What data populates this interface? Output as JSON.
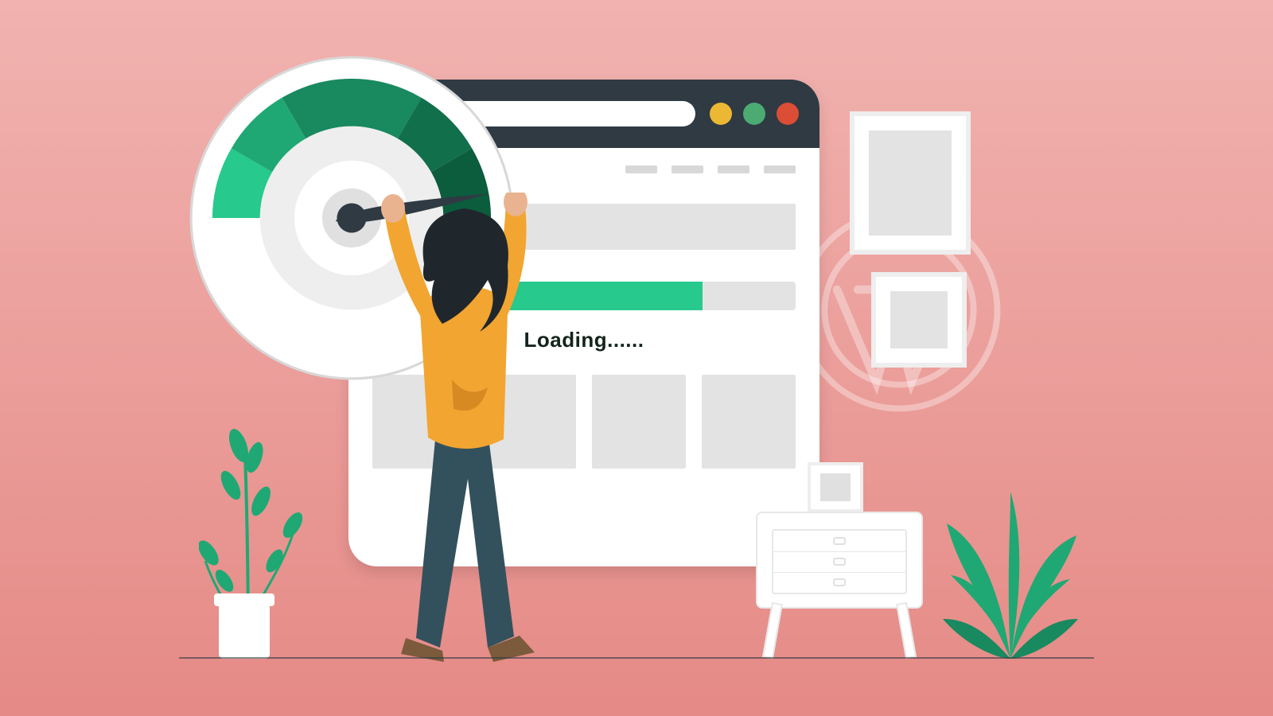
{
  "browser": {
    "header_dot_colors": {
      "yellow": "#ecb834",
      "green": "#4bab72",
      "red": "#db4d34"
    },
    "nav_dash_count": 4,
    "loading_label": "Loading......",
    "progress_percent": 78,
    "thumbnail_count": 4
  },
  "gauge": {
    "segments": [
      "#27c98d",
      "#1fa874",
      "#19895f",
      "#116f4c",
      "#0c5c3e"
    ],
    "needle_color": "#2f3a43"
  },
  "frames_right": 2
}
